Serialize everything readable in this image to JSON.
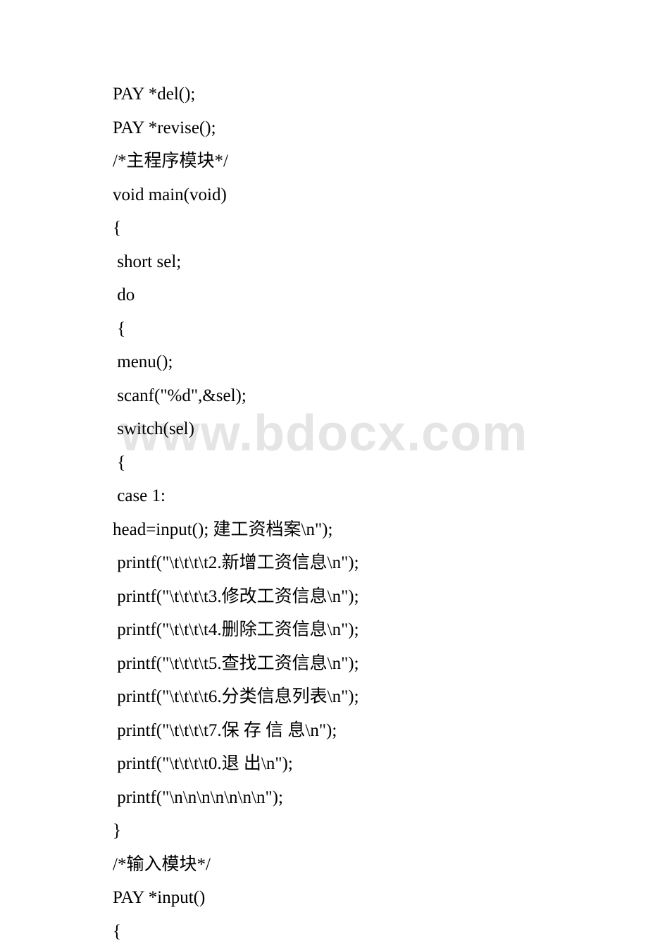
{
  "watermark": "www.bdocx.com",
  "lines": [
    "PAY *del();",
    "PAY *revise();",
    "/*主程序模块*/",
    "void main(void)",
    "{",
    " short sel;",
    " do",
    " {",
    " menu();",
    " scanf(\"%d\",&sel);",
    " switch(sel)",
    " {",
    " case 1:",
    "head=input(); 建工资档案\\n\");",
    " printf(\"\\t\\t\\t\\t2.新增工资信息\\n\");",
    " printf(\"\\t\\t\\t\\t3.修改工资信息\\n\");",
    " printf(\"\\t\\t\\t\\t4.删除工资信息\\n\");",
    " printf(\"\\t\\t\\t\\t5.查找工资信息\\n\");",
    " printf(\"\\t\\t\\t\\t6.分类信息列表\\n\");",
    " printf(\"\\t\\t\\t\\t7.保 存 信 息\\n\");",
    " printf(\"\\t\\t\\t\\t0.退 出\\n\");",
    " printf(\"\\n\\n\\n\\n\\n\\n\\n\");",
    "}",
    "/*输入模块*/",
    "PAY *input()",
    "{"
  ]
}
